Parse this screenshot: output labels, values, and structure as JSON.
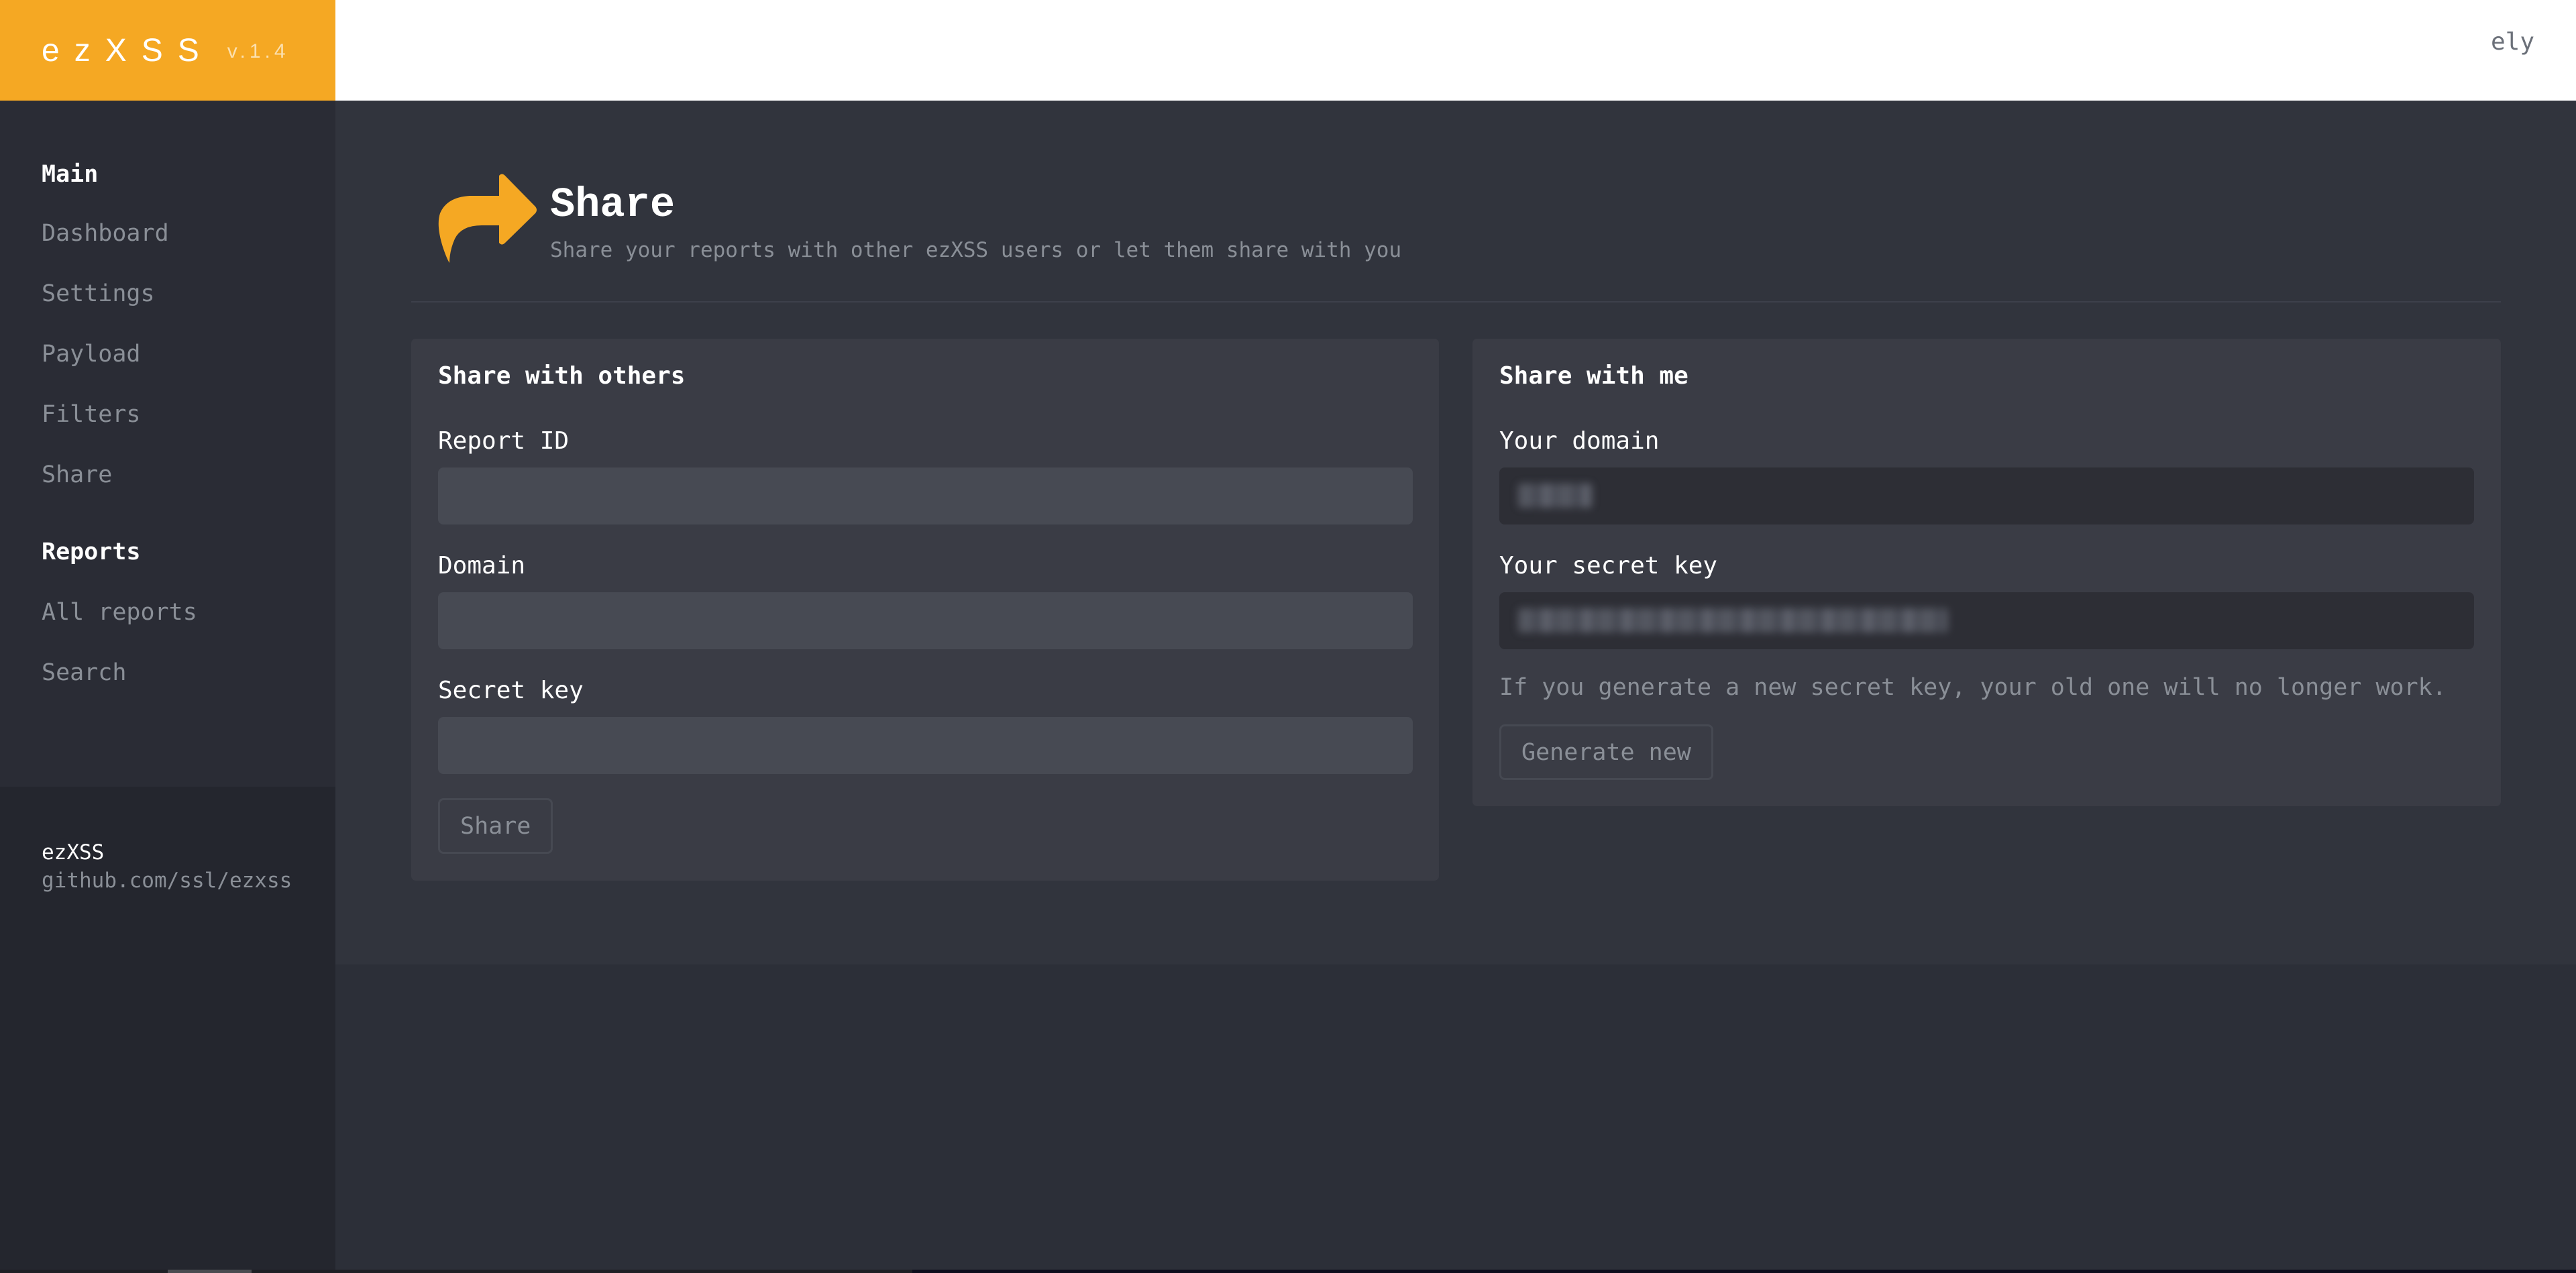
{
  "app": {
    "name": "ezXSS",
    "version": "v.1.4",
    "brand_color": "#f5a823"
  },
  "header": {
    "user": "ely"
  },
  "sidebar": {
    "sections": [
      {
        "heading": "Main",
        "items": [
          {
            "label": "Dashboard"
          },
          {
            "label": "Settings"
          },
          {
            "label": "Payload"
          },
          {
            "label": "Filters"
          },
          {
            "label": "Share"
          }
        ]
      },
      {
        "heading": "Reports",
        "items": [
          {
            "label": "All reports"
          },
          {
            "label": "Search"
          }
        ]
      }
    ],
    "footer": {
      "name": "ezXSS",
      "link": "github.com/ssl/ezxss"
    }
  },
  "page": {
    "icon": "share-icon",
    "title": "Share",
    "subtitle": "Share your reports with other ezXSS users or let them share with you"
  },
  "share_with_others": {
    "title": "Share with others",
    "fields": [
      {
        "label": "Report ID",
        "value": "",
        "placeholder": ""
      },
      {
        "label": "Domain",
        "value": "",
        "placeholder": ""
      },
      {
        "label": "Secret key",
        "value": "",
        "placeholder": ""
      }
    ],
    "submit_label": "Share"
  },
  "share_with_me": {
    "title": "Share with me",
    "domain_label": "Your domain",
    "domain_value": "[redacted]",
    "secret_label": "Your secret key",
    "secret_value": "[redacted]",
    "help_text": "If you generate a new secret key, your old one will no longer work.",
    "generate_label": "Generate new"
  }
}
